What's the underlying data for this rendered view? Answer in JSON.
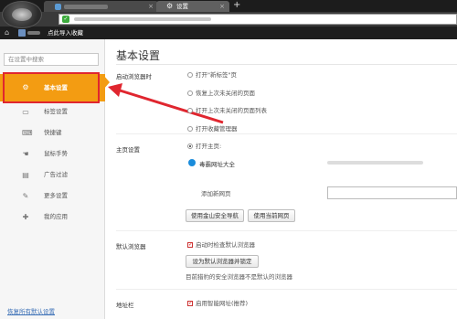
{
  "tabs": [
    {
      "label": "",
      "close": "×"
    },
    {
      "label": "设置",
      "close": "×"
    }
  ],
  "new_tab": "+",
  "bookmarks": {
    "home": "⌂",
    "item": "点此导入收藏"
  },
  "sidebar": {
    "search_placeholder": "在设置中搜索",
    "items": [
      {
        "label": "基本设置",
        "icon": "gear-icon",
        "glyph": "⚙",
        "active": true
      },
      {
        "label": "标签设置",
        "icon": "tab-icon",
        "glyph": "▭"
      },
      {
        "label": "快捷键",
        "icon": "keyboard-icon",
        "glyph": "⌨"
      },
      {
        "label": "鼠标手势",
        "icon": "mouse-gesture-icon",
        "glyph": "☚"
      },
      {
        "label": "广告过滤",
        "icon": "ad-filter-icon",
        "glyph": "▤"
      },
      {
        "label": "更多设置",
        "icon": "wrench-icon",
        "glyph": "✎"
      },
      {
        "label": "我的应用",
        "icon": "apps-icon",
        "glyph": "✚"
      }
    ],
    "restore_link": "恢复所有默认设置"
  },
  "main": {
    "title": "基本设置",
    "startup": {
      "label": "启动浏览器时",
      "options": [
        {
          "label": "打开\"新标签\"页",
          "selected": false
        },
        {
          "label": "恢复上次未关闭的页面",
          "selected": false
        },
        {
          "label": "打开上次未关闭的页面列表",
          "selected": false
        },
        {
          "label": "打开收藏管理器",
          "selected": false
        },
        {
          "label": "打开主页:",
          "selected": true
        }
      ]
    },
    "homepage": {
      "label": "主页设置",
      "site": "毒霸网址大全",
      "add_new": "添加新网页",
      "btn_kingsoft": "使用金山安全导航",
      "btn_current": "使用当前网页"
    },
    "default_browser": {
      "label": "默认浏览器",
      "check_label": "启动时检查默认浏览器",
      "checked": true,
      "btn_set": "设为默认浏览器并锁定",
      "note": "目前猎豹的安全浏览器不是默认的浏览器"
    },
    "address_bar": {
      "label": "地址栏",
      "check_label": "启用智能网址(推荐)",
      "checked": true
    }
  },
  "colors": {
    "accent": "#f39c12",
    "annotation_red": "#e0262f",
    "link": "#3a6fb6"
  }
}
